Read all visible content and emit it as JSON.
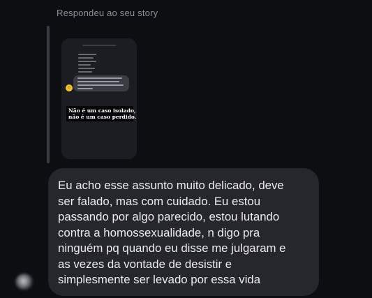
{
  "reply_header": "Respondeu ao seu story",
  "story_preview": {
    "caption_line1": "Não é um caso isolado,",
    "caption_line2": "não é um caso perdido.",
    "emoji_icon": "smiling-face-icon"
  },
  "message": {
    "text": "Eu acho esse assunto muito delicado, deve\nser falado, mas com cuidado. Eu estou\npassando por algo parecido, estou lutando\ncontra a homossexualidade, n digo pra\nninguém pq quando eu disse me julgaram e\nas vezes da vontade de desistir e\nsimplesmente ser levado por essa vida"
  },
  "colors": {
    "background": "#0d0e12",
    "bubble": "#26272c",
    "header_text": "#8d8f96",
    "message_text": "#ececef"
  }
}
